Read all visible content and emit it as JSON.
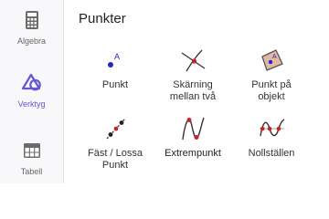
{
  "sidebar": {
    "items": [
      {
        "label": "Algebra",
        "icon": "calculator-icon"
      },
      {
        "label": "Verktyg",
        "icon": "shapes-icon",
        "active": true
      },
      {
        "label": "Tabell",
        "icon": "table-icon"
      }
    ]
  },
  "section": {
    "title": "Punkter"
  },
  "tools": [
    {
      "label": "Punkt",
      "icon": "point-icon"
    },
    {
      "label": "Skärning\nmellan två",
      "icon": "intersect-icon"
    },
    {
      "label": "Punkt på\nobjekt",
      "icon": "point-on-object-icon"
    },
    {
      "label": "Fäst / Lossa\nPunkt",
      "icon": "attach-detach-point-icon"
    },
    {
      "label": "Extrempunkt",
      "icon": "extremum-icon"
    },
    {
      "label": "Nollställen",
      "icon": "roots-icon"
    }
  ],
  "colors": {
    "accent": "#6557d2",
    "point_blue": "#1a2bbd",
    "point_red": "#cc2222",
    "polygon_fill": "#e3b9a6"
  }
}
